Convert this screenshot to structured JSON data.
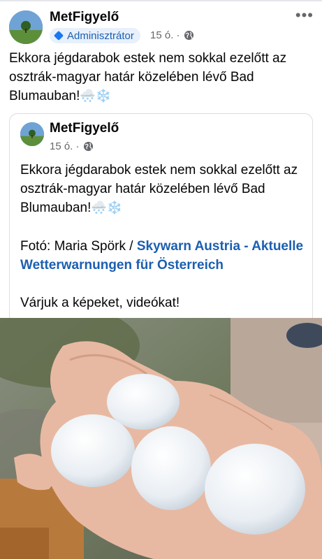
{
  "post": {
    "page_name": "MetFigyelő",
    "role_badge": "Adminisztrátor",
    "time": "15 ó. ·",
    "text": "Ekkora jégdarabok estek nem sokkal ezelőtt az osztrák-magyar határ közelében lévő Bad Blumauban!",
    "emoji": "🌨️❄️"
  },
  "shared": {
    "page_name": "MetFigyelő",
    "time": "15 ó. ·",
    "text": "Ekkora jégdarabok estek nem sokkal ezelőtt az osztrák-magyar határ közelében lévő Bad Blumauban!",
    "emoji": "🌨️❄️",
    "credit_prefix": "Fotó: Maria Spörk / ",
    "credit_link": "Skywarn Austria - Aktuelle Wetterwarnungen für Österreich",
    "call_to_action": "Várjuk a képeket, videókat!"
  },
  "icons": {
    "more": "more-options-icon",
    "privacy": "globe-icon",
    "badge": "admin-diamond-icon"
  },
  "colors": {
    "link": "#1b5fb0",
    "badge_bg": "#e7f0fb",
    "secondary_text": "#65676b"
  }
}
